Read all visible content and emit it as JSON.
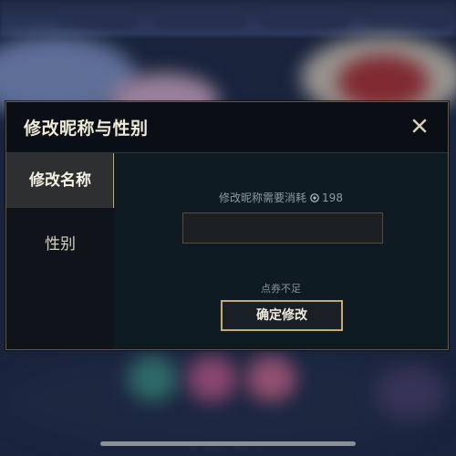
{
  "dialog": {
    "title": "修改昵称与性别",
    "close_icon": "close-icon"
  },
  "sidebar": {
    "items": [
      {
        "label": "修改名称",
        "active": true
      },
      {
        "label": "性别",
        "active": false
      }
    ]
  },
  "rename": {
    "cost_label": "修改昵称需要消耗",
    "cost_amount": "198",
    "cost_icon": "coupon-icon",
    "input_value": "",
    "input_placeholder": "",
    "warning": "点券不足",
    "confirm_label": "确定修改"
  },
  "colors": {
    "accent_gold": "#c8aa6e",
    "panel_bg": "#0f1b22",
    "active_tab_bg": "#2e2f31"
  }
}
